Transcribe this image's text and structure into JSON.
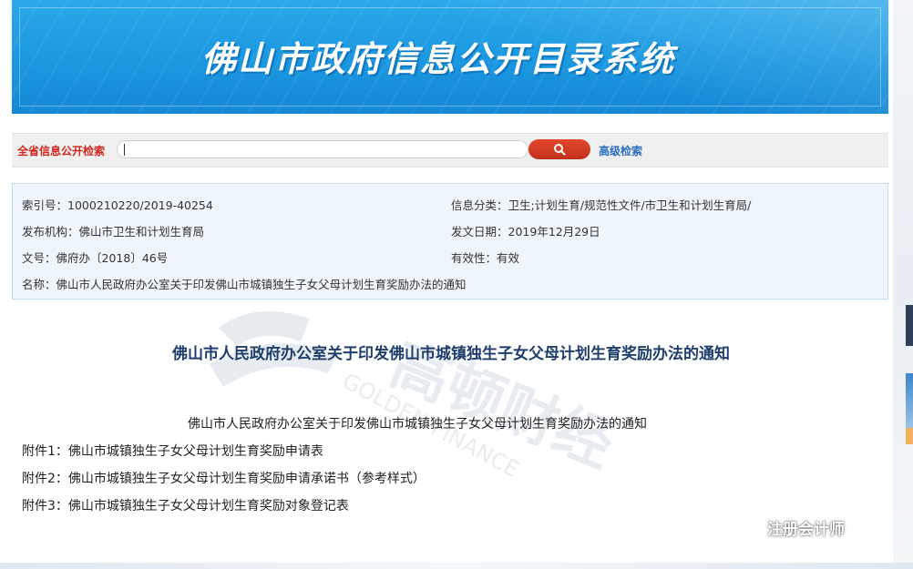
{
  "banner": {
    "title": "佛山市政府信息公开目录系统"
  },
  "search": {
    "label": "全省信息公开检索",
    "placeholder": "",
    "advanced_label": "高级检索"
  },
  "info": {
    "index_label": "索引号：",
    "index_value": "1000210220/2019-40254",
    "category_label": "信息分类：",
    "category_value": "卫生;计划生育/规范性文件/市卫生和计划生育局/",
    "org_label": "发布机构：",
    "org_value": "佛山市卫生和计划生育局",
    "date_label": "发文日期：",
    "date_value": "2019年12月29日",
    "docno_label": "文号：",
    "docno_value": "佛府办〔2018〕46号",
    "validity_label": "有效性：",
    "validity_value": "有效",
    "name_label": "名称：",
    "name_value": "佛山市人民政府办公室关于印发佛山市城镇独生子女父母计划生育奖励办法的通知"
  },
  "document": {
    "title": "佛山市人民政府办公室关于印发佛山市城镇独生子女父母计划生育奖励办法的通知",
    "notice_link": "佛山市人民政府办公室关于印发佛山市城镇独生子女父母计划生育奖励办法的通知",
    "attachments": [
      "附件1：佛山市城镇独生子女父母计划生育奖励申请表",
      "附件2：佛山市城镇独生子女父母计划生育奖励申请承诺书（参考样式）",
      "附件3：佛山市城镇独生子女父母计划生育奖励对象登记表"
    ]
  },
  "watermark": {
    "cn": "高顿财经",
    "en": "GOLDEN FINANCE"
  },
  "wechat": {
    "account": "注册会计师"
  },
  "colors": {
    "banner": "#1b97e0",
    "search_label": "#d4251c",
    "search_button": "#c0321a",
    "link": "#2a6cbf",
    "doc_title": "#1f3e6b",
    "info_bg": "#eef5fb"
  }
}
